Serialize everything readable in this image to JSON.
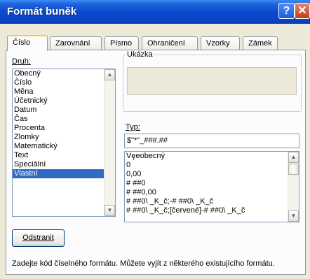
{
  "window": {
    "title": "Formát buněk",
    "help_glyph": "?",
    "close_glyph": "✕"
  },
  "tabs": [
    {
      "label": "Číslo",
      "active": true
    },
    {
      "label": "Zarovnání",
      "active": false
    },
    {
      "label": "Písmo",
      "active": false
    },
    {
      "label": "Ohraničení",
      "active": false
    },
    {
      "label": "Vzorky",
      "active": false
    },
    {
      "label": "Zámek",
      "active": false
    }
  ],
  "category": {
    "label": "Druh:",
    "items": [
      "Obecný",
      "Číslo",
      "Měna",
      "Účetnický",
      "Datum",
      "Čas",
      "Procenta",
      "Zlomky",
      "Matematický",
      "Text",
      "Speciální",
      "Vlastní"
    ],
    "selected": "Vlastní"
  },
  "sample": {
    "label": "Ukázka"
  },
  "type": {
    "label": "Typ:",
    "value": "$\"*\"_###.##",
    "items": [
      "Vęeobecný",
      "0",
      "0,00",
      "# ##0",
      "# ##0,00",
      "# ##0\\ _K_č;-# ##0\\ _K_č",
      "# ##0\\ _K_č;[červené]-# ##0\\ _K_č"
    ]
  },
  "delete_button": {
    "label": "Odstranit"
  },
  "description": "Zadejte kód číselného formátu. Můžete vyjít z některého existujícího formátu.",
  "colors": {
    "title_bar": "#0a4ad0",
    "selection": "#316ac5",
    "tab_highlight": "#ffc83c"
  },
  "icons": {
    "help": "question-icon",
    "close": "close-icon",
    "scroll_up": "up-arrow-icon",
    "scroll_down": "down-arrow-icon"
  }
}
